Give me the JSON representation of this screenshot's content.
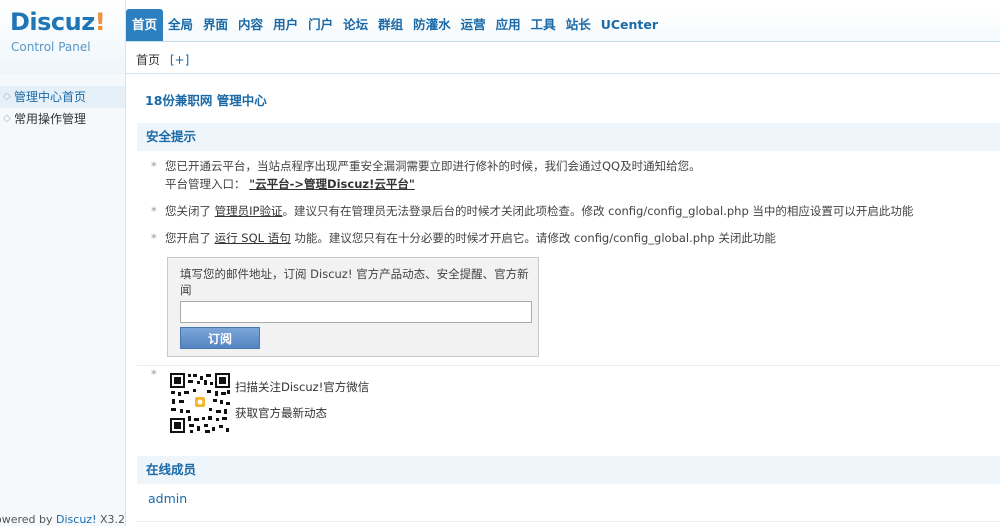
{
  "logo": {
    "brand": "Discuz",
    "bang": "!",
    "subtitle": "Control Panel"
  },
  "nav": {
    "items": [
      "首页",
      "全局",
      "界面",
      "内容",
      "用户",
      "门户",
      "论坛",
      "群组",
      "防灌水",
      "运营",
      "应用",
      "工具",
      "站长",
      "UCenter"
    ],
    "active_index": 0
  },
  "subnav": {
    "home": "首页",
    "add": "[+]"
  },
  "sidebar": {
    "items": [
      {
        "label": "管理中心首页",
        "active": true
      },
      {
        "label": "常用操作管理",
        "active": false
      }
    ],
    "powered_prefix": "owered by",
    "powered_link": "Discuz!",
    "powered_version": "X3.2"
  },
  "main": {
    "title": "18份兼职网 管理中心",
    "security_heading": "安全提示",
    "tips": [
      {
        "line1": "您已开通云平台，当站点程序出现严重安全漏洞需要立即进行修补的时候，我们会通过QQ及时通知给您。",
        "line2_prefix": "平台管理入口：",
        "line2_link": "\"云平台->管理Discuz!云平台\""
      },
      {
        "prefix": "您关闭了 ",
        "link": "管理员IP验证",
        "suffix": "。建议只有在管理员无法登录后台的时候才关闭此项检查。修改 config/config_global.php 当中的相应设置可以开启此功能"
      },
      {
        "prefix": "您开启了 ",
        "link": "运行 SQL 语句",
        "suffix": " 功能。建议您只有在十分必要的时候才开启它。请修改 config/config_global.php 关闭此功能"
      }
    ],
    "subscribe": {
      "label": "填写您的邮件地址，订阅 Discuz! 官方产品动态、安全提醒、官方新闻",
      "value": "",
      "button": "订阅"
    },
    "wechat": {
      "line1": "扫描关注Discuz!官方微信",
      "line2": "获取官方最新动态"
    },
    "online_heading": "在线成员",
    "online_members": [
      "admin"
    ]
  },
  "colors": {
    "accent": "#1b6aa7",
    "nav_active": "#2d80c0",
    "logo_orange": "#f3913a",
    "section_bg": "#eef5fb"
  }
}
